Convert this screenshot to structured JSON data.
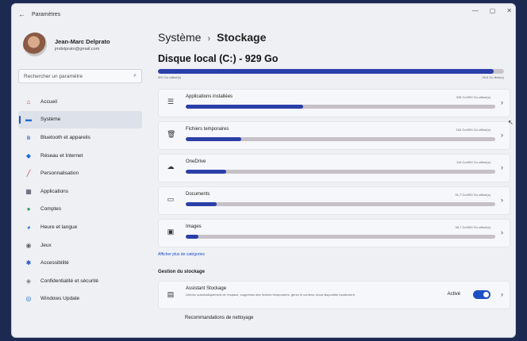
{
  "window": {
    "title": "Paramètres",
    "back_icon": "back-arrow-icon",
    "controls": [
      "—",
      "▢",
      "✕"
    ]
  },
  "profile": {
    "name": "Jean-Marc Delprato",
    "email": "jmdelprato@gmail.com"
  },
  "search": {
    "placeholder": "Rechercher un paramètre",
    "icon": "search-icon"
  },
  "nav": [
    {
      "label": "Accueil",
      "icon": "home-icon",
      "glyph": "⌂",
      "color": "#c0392b"
    },
    {
      "label": "Système",
      "icon": "monitor-icon",
      "glyph": "▬",
      "color": "#1d6fd6",
      "active": true
    },
    {
      "label": "Bluetooth et appareils",
      "icon": "bluetooth-icon",
      "glyph": "ʙ",
      "color": "#1d4fc4"
    },
    {
      "label": "Réseau et Internet",
      "icon": "wifi-icon",
      "glyph": "◆",
      "color": "#1d6fd6"
    },
    {
      "label": "Personnalisation",
      "icon": "brush-icon",
      "glyph": "╱",
      "color": "#c0392b"
    },
    {
      "label": "Applications",
      "icon": "apps-icon",
      "glyph": "▦",
      "color": "#445"
    },
    {
      "label": "Comptes",
      "icon": "account-icon",
      "glyph": "●",
      "color": "#2e9e5b"
    },
    {
      "label": "Heure et langue",
      "icon": "globe-clock-icon",
      "glyph": "◕",
      "color": "#1d6fd6"
    },
    {
      "label": "Jeux",
      "icon": "gamepad-icon",
      "glyph": "◉",
      "color": "#666"
    },
    {
      "label": "Accessibilité",
      "icon": "accessibility-icon",
      "glyph": "✱",
      "color": "#1d4fc4"
    },
    {
      "label": "Confidentialité et sécurité",
      "icon": "shield-icon",
      "glyph": "◈",
      "color": "#777"
    },
    {
      "label": "Windows Update",
      "icon": "update-icon",
      "glyph": "◎",
      "color": "#1d6fd6"
    }
  ],
  "breadcrumb": {
    "parent": "Système",
    "separator": "›",
    "current": "Stockage"
  },
  "disk": {
    "title": "Disque local (C:) - 929 Go",
    "used_label": "900 Go utilisé(s)",
    "free_label": "28,8 Go libre(s)",
    "used_fraction": 0.97
  },
  "categories": [
    {
      "label": "Applications installées",
      "usage": "345 Go/900 Go utilisé(s)",
      "icon": "apps-list-icon",
      "glyph": "☰",
      "fraction": 0.38
    },
    {
      "label": "Fichiers temporaires",
      "usage": "164 Go/900 Go utilisé(s)",
      "icon": "trash-icon",
      "glyph": "🗑",
      "fraction": 0.18
    },
    {
      "label": "OneDrive",
      "usage": "116 Go/900 Go utilisé(s)",
      "icon": "cloud-icon",
      "glyph": "☁",
      "fraction": 0.13
    },
    {
      "label": "Documents",
      "usage": "91,7 Go/900 Go utilisé(s)",
      "icon": "document-icon",
      "glyph": "▭",
      "fraction": 0.1
    },
    {
      "label": "Images",
      "usage": "38,7 Go/900 Go utilisé(s)",
      "icon": "image-icon",
      "glyph": "▣",
      "fraction": 0.04
    }
  ],
  "more_categories": "Afficher plus de catégories",
  "management": {
    "title": "Gestion du stockage",
    "assistant": {
      "title": "Assistant Stockage",
      "description": "Libérez automatiquement de l'espace, supprimez des fichiers temporaires, gérez le contenu cloud disponible localement.",
      "state": "Activé",
      "enabled": true,
      "icon": "storage-sense-icon",
      "glyph": "▤"
    },
    "recommendations": "Recommandations de nettoyage"
  },
  "chevron": "›"
}
